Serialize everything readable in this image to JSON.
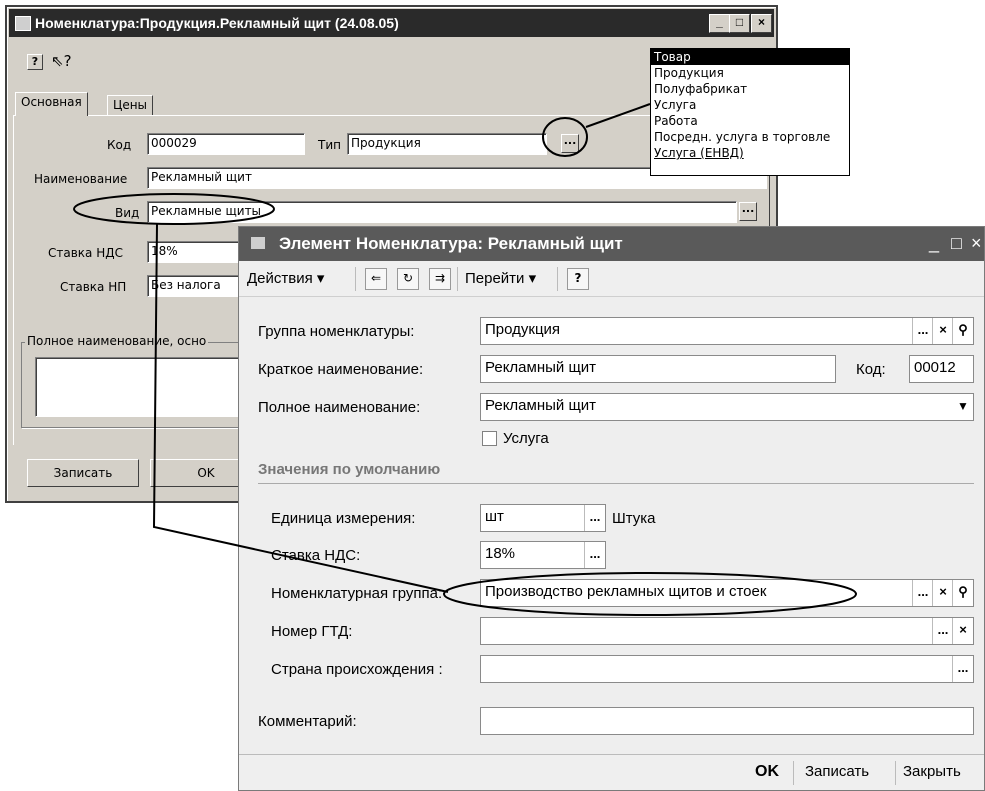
{
  "w1": {
    "title": "Номенклатура:Продукция.Рекламный щит (24.08.05)",
    "controls": {
      "min": "_",
      "max": "□",
      "close": "×"
    },
    "tabs": [
      "Основная",
      "Цены"
    ],
    "code_label": "Код",
    "code_value": "000029",
    "type_label": "Тип",
    "type_value": "Продукция",
    "name_label": "Наименование",
    "name_value": "Рекламный щит",
    "kind_label": "Вид",
    "kind_value": "Рекламные щиты",
    "vat_label": "Ставка НДС",
    "vat_value": "18%",
    "tax_label": "Ставка НП",
    "tax_value": "Без налога",
    "fullname_label": "Полное наименование, осно",
    "save_button": "Записать",
    "ok_button": "OK",
    "ellipsis": "..."
  },
  "dropdown": {
    "items": [
      "Товар",
      "Продукция",
      "Полуфабрикат",
      "Услуга",
      "Работа",
      "Посредн. услуга в торговле",
      "Услуга (ЕНВД)"
    ],
    "selected": "Товар"
  },
  "w2": {
    "title": "Элемент Номенклатура: Рекламный щит",
    "controls": {
      "min": "_",
      "max": "□",
      "close": "×"
    },
    "toolbar": {
      "actions": "Действия ▾",
      "goto": "Перейти ▾",
      "help": "?"
    },
    "group_label": "Группа номенклатуры:",
    "group_value": "Продукция",
    "short_label": "Краткое наименование:",
    "short_value": "Рекламный щит",
    "code_label": "Код:",
    "code_value": "00012",
    "full_label": "Полное наименование:",
    "full_value": "Рекламный щит",
    "service_label": "Услуга",
    "defaults_header": "Значения по умолчанию",
    "unit_label": "Единица измерения:",
    "unit_value": "шт",
    "unit_name": "Штука",
    "vat_label": "Ставка НДС:",
    "vat_value": "18%",
    "nomgroup_label": "Номенклатурная группа:",
    "nomgroup_value": "Производство рекламных щитов и стоек",
    "gtd_label": "Номер ГТД:",
    "country_label": "Страна происхождения :",
    "comment_label": "Комментарий:",
    "buttons": {
      "ok": "OK",
      "save": "Записать",
      "close": "Закрыть"
    },
    "ellipsis": "...",
    "clear_glyph": "×",
    "search_glyph": "⚲",
    "dropdown_glyph": "▼"
  }
}
